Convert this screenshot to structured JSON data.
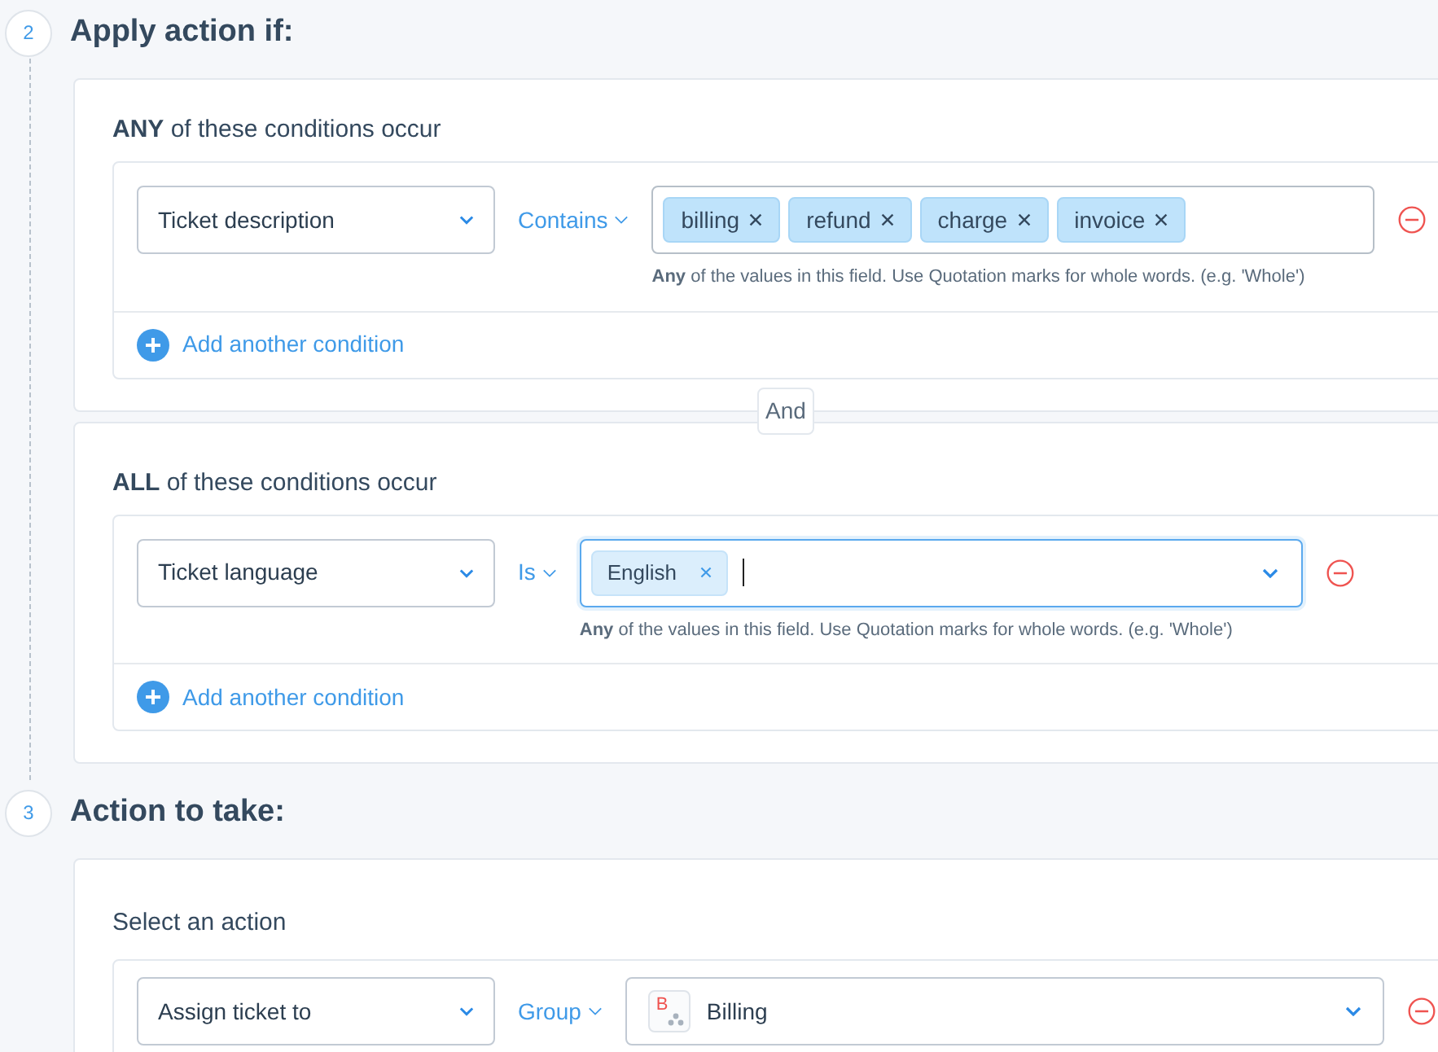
{
  "steps": [
    {
      "number": "2",
      "title": "Apply action if:",
      "kind": "conditions",
      "groups": [
        {
          "heading": "**ANY** of these conditions occur",
          "conditions": [
            {
              "field": "Ticket description",
              "operator": "Contains",
              "values": [
                "billing",
                "refund",
                "charge",
                "invoice"
              ],
              "focused": false,
              "dropdown": false,
              "hint": "**Any** of the values in this field. Use Quotation marks for whole words. (e.g. 'Whole')"
            }
          ],
          "add_label": "Add another condition"
        },
        {
          "heading": "**ALL** of these conditions occur",
          "conditions": [
            {
              "field": "Ticket language",
              "operator": "Is",
              "values": [
                "English"
              ],
              "focused": true,
              "dropdown": true,
              "hint": "**Any** of the values in this field. Use Quotation marks for whole words. (e.g. 'Whole')"
            }
          ],
          "add_label": "Add another condition"
        }
      ],
      "joiner": "And"
    },
    {
      "number": "3",
      "title": "Action to take:",
      "kind": "action",
      "heading": "Select an action",
      "action": "Assign ticket to",
      "operator": "Group",
      "target": {
        "badge": "B",
        "label": "Billing"
      }
    }
  ]
}
